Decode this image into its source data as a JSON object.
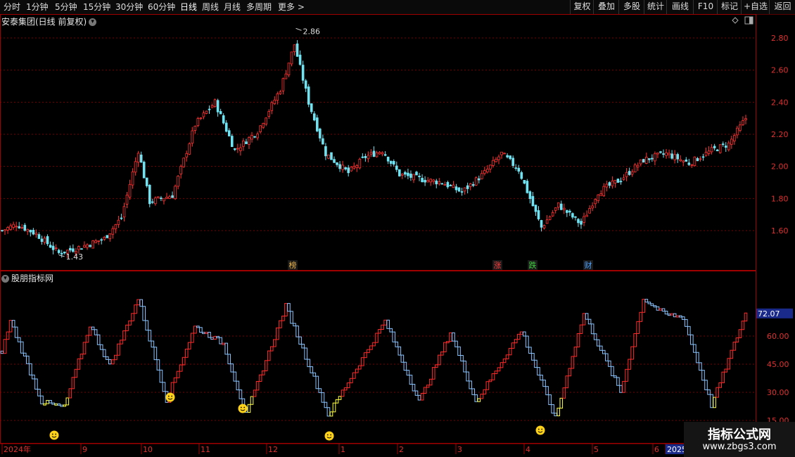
{
  "toolbar": {
    "periods": [
      "分时",
      "1分钟",
      "5分钟",
      "15分钟",
      "30分钟",
      "60分钟",
      "日线",
      "周线",
      "月线",
      "多周期",
      "更多 >"
    ],
    "active_period": "日线",
    "right_buttons": [
      "复权",
      "叠加",
      "多股",
      "统计",
      "画线",
      "F10",
      "标记",
      "+自选",
      "返回"
    ]
  },
  "main_chart": {
    "title": "安泰集团(日线 前复权)",
    "ylabels": [
      "2.80",
      "2.60",
      "2.40",
      "2.20",
      "2.00",
      "1.80",
      "1.60"
    ],
    "high_label": "2.86",
    "low_label": "1.43",
    "event_markers": [
      {
        "label": "榜",
        "color": "#e8b24a"
      },
      {
        "label": "涨",
        "color": "#ff4040"
      },
      {
        "label": "跌",
        "color": "#40d040"
      },
      {
        "label": "财",
        "color": "#4aa0ff"
      }
    ]
  },
  "indicator": {
    "title": "股朋指标网",
    "current_value": "72.07",
    "ylabels": [
      "60.00",
      "45.00",
      "30.00",
      "15.00"
    ]
  },
  "date_axis": [
    "2024年",
    "9",
    "10",
    "11",
    "12",
    "1",
    "2",
    "3",
    "4",
    "5",
    "6",
    "2025"
  ],
  "colors": {
    "up": "#ff3333",
    "down": "#6fe3f2",
    "ind_up": "#ff2a2a",
    "ind_down": "#8ac4ff",
    "ind_low": "#ffff44",
    "grid": "#7a0000",
    "border": "#a00000",
    "smiley": "#ffd21a"
  },
  "watermark": {
    "line1": "指标公式网",
    "line2": "www.zbgs3.com"
  },
  "chart_data": {
    "type": "candlestick",
    "title": "安泰集团(日线 前复权)",
    "ylim": [
      1.43,
      2.86
    ],
    "annotations": [
      {
        "text": "2.86",
        "kind": "period-high"
      },
      {
        "text": "1.43",
        "kind": "period-low"
      }
    ],
    "close_path_points": [
      {
        "t": 0,
        "v": 1.6
      },
      {
        "t": 5,
        "v": 1.64
      },
      {
        "t": 12,
        "v": 1.58
      },
      {
        "t": 20,
        "v": 1.46
      },
      {
        "t": 28,
        "v": 1.5
      },
      {
        "t": 36,
        "v": 1.55
      },
      {
        "t": 42,
        "v": 1.68
      },
      {
        "t": 48,
        "v": 2.1
      },
      {
        "t": 52,
        "v": 1.78
      },
      {
        "t": 60,
        "v": 1.82
      },
      {
        "t": 68,
        "v": 2.26
      },
      {
        "t": 75,
        "v": 2.4
      },
      {
        "t": 82,
        "v": 2.1
      },
      {
        "t": 90,
        "v": 2.22
      },
      {
        "t": 98,
        "v": 2.48
      },
      {
        "t": 103,
        "v": 2.76
      },
      {
        "t": 108,
        "v": 2.4
      },
      {
        "t": 114,
        "v": 2.08
      },
      {
        "t": 122,
        "v": 1.96
      },
      {
        "t": 128,
        "v": 2.06
      },
      {
        "t": 134,
        "v": 2.1
      },
      {
        "t": 140,
        "v": 1.95
      },
      {
        "t": 148,
        "v": 1.92
      },
      {
        "t": 155,
        "v": 1.9
      },
      {
        "t": 162,
        "v": 1.84
      },
      {
        "t": 170,
        "v": 1.96
      },
      {
        "t": 176,
        "v": 2.08
      },
      {
        "t": 182,
        "v": 1.98
      },
      {
        "t": 186,
        "v": 1.8
      },
      {
        "t": 190,
        "v": 1.62
      },
      {
        "t": 196,
        "v": 1.76
      },
      {
        "t": 204,
        "v": 1.64
      },
      {
        "t": 210,
        "v": 1.84
      },
      {
        "t": 218,
        "v": 1.92
      },
      {
        "t": 226,
        "v": 2.04
      },
      {
        "t": 234,
        "v": 2.08
      },
      {
        "t": 242,
        "v": 2.02
      },
      {
        "t": 250,
        "v": 2.1
      },
      {
        "t": 256,
        "v": 2.14
      },
      {
        "t": 262,
        "v": 2.3
      }
    ],
    "indicator": {
      "name": "股朋指标网",
      "last_value": 72.07,
      "ylim": [
        15,
        75
      ],
      "oscillation_points": [
        {
          "t": 0,
          "v": 52
        },
        {
          "t": 3,
          "v": 68
        },
        {
          "t": 14,
          "v": 25
        },
        {
          "t": 22,
          "v": 22
        },
        {
          "t": 31,
          "v": 66
        },
        {
          "t": 38,
          "v": 44
        },
        {
          "t": 48,
          "v": 80
        },
        {
          "t": 58,
          "v": 26
        },
        {
          "t": 68,
          "v": 65
        },
        {
          "t": 78,
          "v": 56
        },
        {
          "t": 86,
          "v": 18
        },
        {
          "t": 100,
          "v": 76
        },
        {
          "t": 115,
          "v": 18
        },
        {
          "t": 135,
          "v": 68
        },
        {
          "t": 147,
          "v": 25
        },
        {
          "t": 158,
          "v": 62
        },
        {
          "t": 167,
          "v": 25
        },
        {
          "t": 183,
          "v": 63
        },
        {
          "t": 195,
          "v": 16
        },
        {
          "t": 205,
          "v": 72
        },
        {
          "t": 218,
          "v": 30
        },
        {
          "t": 226,
          "v": 80
        },
        {
          "t": 233,
          "v": 72
        },
        {
          "t": 240,
          "v": 70
        },
        {
          "t": 250,
          "v": 23
        },
        {
          "t": 262,
          "v": 72
        }
      ]
    }
  }
}
